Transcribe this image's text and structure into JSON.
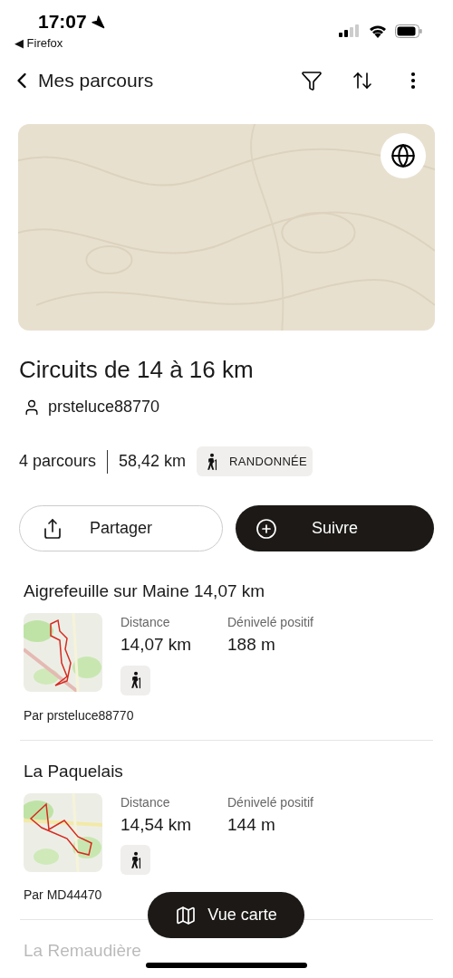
{
  "status_bar": {
    "time": "17:07",
    "back_app": "◀ Firefox"
  },
  "nav": {
    "title": "Mes parcours"
  },
  "collection": {
    "title": "Circuits de 14 à 16 km",
    "author": "prsteluce88770",
    "count": "4 parcours",
    "total_distance": "58,42 km",
    "activity": "RANDONNÉE"
  },
  "actions": [
    {
      "kind": "share",
      "label": "Partager"
    },
    {
      "kind": "follow",
      "label": "Suivre"
    }
  ],
  "routes": [
    {
      "title": "Aigrefeuille sur Maine 14,07 km",
      "distance_label": "Distance",
      "distance": "14,07 km",
      "elevation_label": "Dénivelé positif",
      "elevation": "188 m",
      "author": "Par prsteluce88770",
      "faded": false
    },
    {
      "title": "La Paquelais",
      "distance_label": "Distance",
      "distance": "14,54 km",
      "elevation_label": "Dénivelé positif",
      "elevation": "144 m",
      "author": "Par MD44470",
      "faded": false
    },
    {
      "title": "La Remaudière",
      "faded": true
    }
  ],
  "map_button": {
    "label": "Vue carte"
  }
}
